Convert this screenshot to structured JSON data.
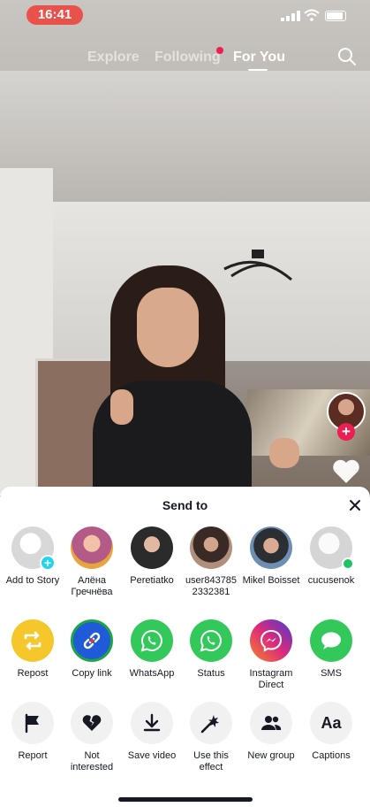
{
  "status_bar": {
    "time": "16:41"
  },
  "topnav": {
    "tabs": [
      {
        "label": "Explore"
      },
      {
        "label": "Following"
      },
      {
        "label": "For You"
      }
    ]
  },
  "share_sheet": {
    "title": "Send to",
    "contacts": [
      {
        "label": "Add to Story",
        "avatar_color": "#e6e6e6",
        "badge": "plus"
      },
      {
        "label": "Алёна Гречнёва",
        "avatar_color": "#c77da0"
      },
      {
        "label": "Peretiatko",
        "avatar_color": "#3a3a3a"
      },
      {
        "label": "user8437852332381",
        "avatar_color": "#6d5a52"
      },
      {
        "label": "Mikel Boisset",
        "avatar_color": "#4a6d8e"
      },
      {
        "label": "cucusenok",
        "avatar_color": "#dedede",
        "badge": "online"
      }
    ],
    "apps": [
      {
        "label": "Repost",
        "color": "#f5c72a",
        "icon": "repost-icon"
      },
      {
        "label": "Copy link",
        "color": "#1c8a3a",
        "icon": "link-icon"
      },
      {
        "label": "WhatsApp",
        "color": "#33c95a",
        "icon": "whatsapp-icon"
      },
      {
        "label": "Status",
        "color": "#33c95a",
        "icon": "whatsapp-status-icon"
      },
      {
        "label": "Instagram Direct",
        "color": "#c13584",
        "icon": "messenger-icon"
      },
      {
        "label": "SMS",
        "color": "#33c95a",
        "icon": "sms-icon"
      }
    ],
    "actions": [
      {
        "label": "Report",
        "icon": "flag-icon"
      },
      {
        "label": "Not interested",
        "icon": "broken-heart-icon"
      },
      {
        "label": "Save video",
        "icon": "download-icon"
      },
      {
        "label": "Use this effect",
        "icon": "effect-icon"
      },
      {
        "label": "New group",
        "icon": "group-icon"
      },
      {
        "label": "Captions",
        "icon": "captions-icon"
      }
    ]
  },
  "colors": {
    "accent": "#ee1d52",
    "cyan": "#20d5ec",
    "status_pill": "#e8524b"
  }
}
